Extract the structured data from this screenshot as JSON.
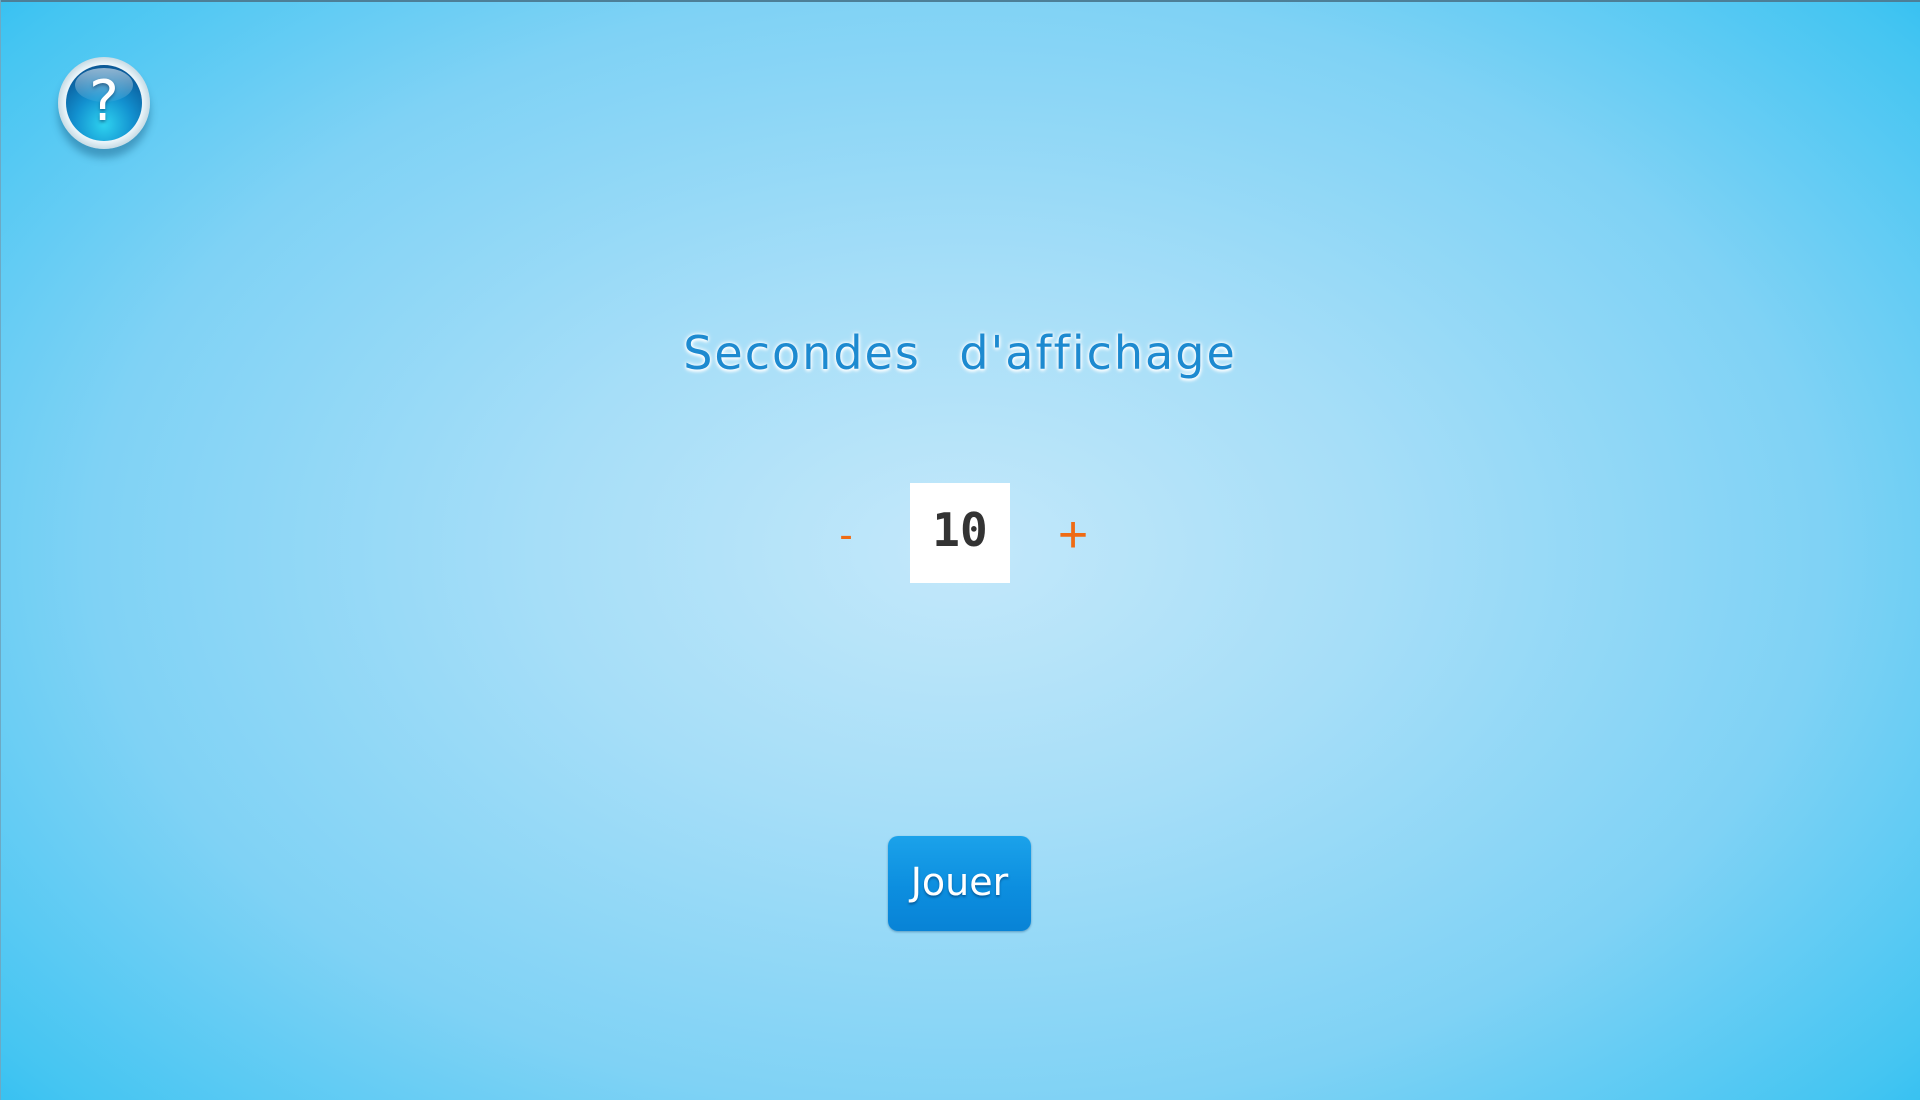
{
  "help": {
    "icon": "help-question-icon",
    "symbol": "?"
  },
  "settings": {
    "title": "Secondes d'affichage",
    "decrement_label": "-",
    "increment_label": "+",
    "seconds_value": "10"
  },
  "actions": {
    "play_label": "Jouer"
  },
  "colors": {
    "title": "#1d8ad0",
    "stepper": "#ef6b14",
    "button": "#0c8edf",
    "background_center": "#c3e8fa",
    "background_edge": "#0ab3ee"
  }
}
